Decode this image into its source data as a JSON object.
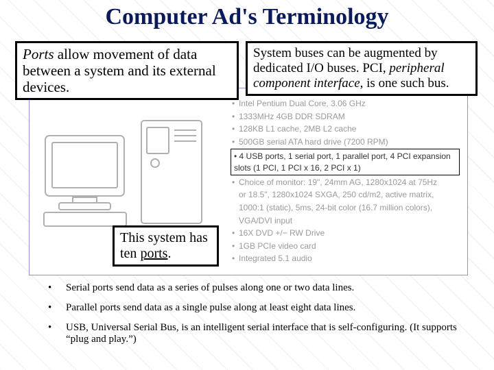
{
  "title": "Computer Ad's Terminology",
  "callouts": {
    "left_html": "<span class='ital'>Ports</span> allow movement of data between a system and its external devices.",
    "right_html": "System buses can be augmented by dedicated I/O buses. PCI, <span class='ital'>peripheral component interface</span>, is one such bus.",
    "small_html": "This system has ten <span class='underline'>ports</span>."
  },
  "specs": [
    "Intel Pentium Dual Core, 3.06 GHz",
    "1333MHz 4GB DDR SDRAM",
    "128KB L1 cache, 2MB L2 cache",
    "500GB serial ATA hard drive (7200 RPM)"
  ],
  "spec_highlight": "4 USB ports, 1 serial port, 1 parallel port, 4 PCI expansion slots (1 PCI, 1 PCI x 16, 2 PCI x 1)",
  "specs_after": [
    "Choice of monitor: 19\", 24mm AG, 1280x1024 at 75Hz",
    "or 18.5\", 1280x1024 SXGA, 250 cd/m2, active matrix,",
    "1000:1 (static), 5ms, 24-bit color (16.7 million colors),",
    "VGA/DVI input",
    "16X DVD +/− RW Drive",
    "1GB PCIe video card",
    "Integrated 5.1 audio"
  ],
  "bottom": [
    "Serial ports send data as a series of pulses along one or two data lines.",
    "Parallel ports send data as a single pulse along at least eight data lines.",
    "USB, Universal Serial Bus, is an intelligent serial interface that is self-configuring.  (It supports “plug and play.”)"
  ]
}
